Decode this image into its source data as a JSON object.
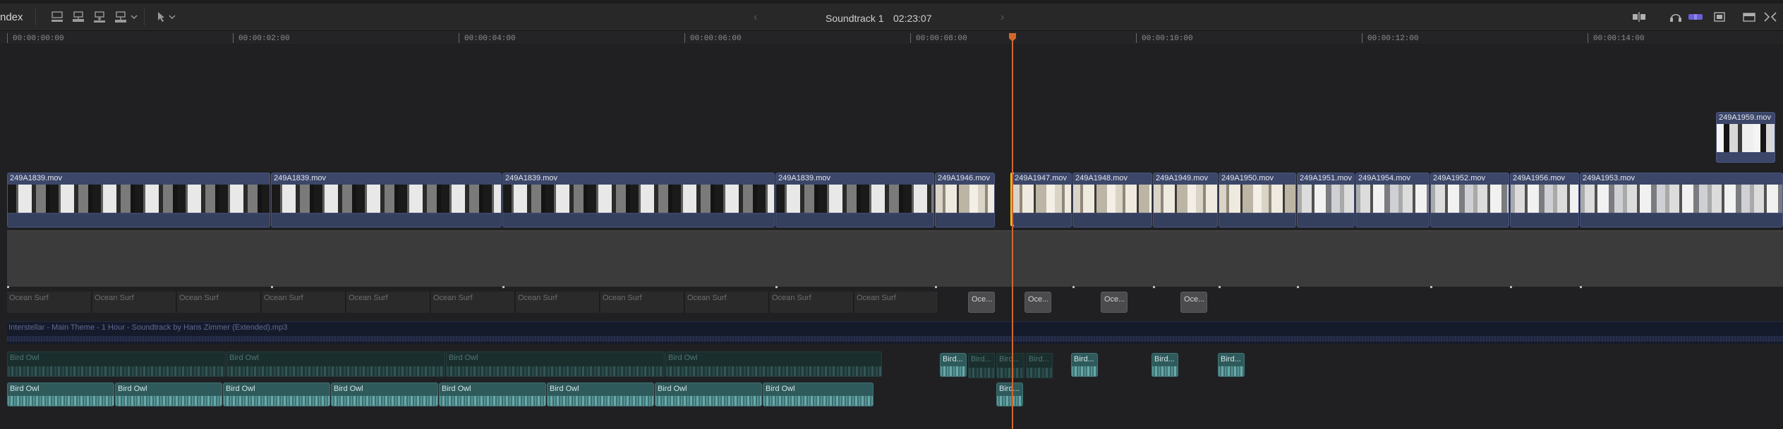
{
  "toolbar": {
    "index_label": "ndex",
    "project_title": "Soundtrack 1",
    "duration": "02:23:07",
    "prev_chevron": "‹",
    "next_chevron": "›"
  },
  "ruler": {
    "labels": [
      "00:00:00:00",
      "00:00:02:00",
      "00:00:04:00",
      "00:00:06:00",
      "00:00:08:00",
      "00:00:10:00",
      "00:00:12:00",
      "00:00:14:00"
    ]
  },
  "timeline": {
    "connected_clip": "249A1959.mov",
    "video_clips": [
      "249A1839.mov",
      "249A1839.mov",
      "249A1839.mov",
      "249A1839.mov",
      "249A1946.mov",
      "249A1947.mov",
      "249A1948.mov",
      "249A1949.mov",
      "249A1950.mov",
      "249A1951.mov",
      "249A1954.mov",
      "249A1952.mov",
      "249A1956.mov",
      "249A1953.mov"
    ],
    "ocean_surf": [
      "Ocean Surf",
      "Ocean Surf",
      "Ocean Surf",
      "Ocean Surf",
      "Ocean Surf",
      "Ocean Surf",
      "Ocean Surf",
      "Ocean Surf",
      "Ocean Surf",
      "Ocean Surf",
      "Ocean Surf"
    ],
    "ocean_short": [
      "Oce...",
      "Oce...",
      "Oce...",
      "Oce..."
    ],
    "music_clip": "Interstellar - Main Theme - 1 Hour - Soundtrack by Hans Zimmer (Extended).mp3",
    "bird_owl_upper": [
      "Bird Owl",
      "Bird Owl",
      "Bird Owl",
      "Bird Owl"
    ],
    "bird_short_upper": [
      "Bird...",
      "Bird...",
      "Bird...",
      "Bird...",
      "Bird...",
      "Bird...",
      "Bird..."
    ],
    "bird_owl_lower": [
      "Bird Owl",
      "Bird Owl",
      "Bird Owl",
      "Bird Owl",
      "Bird Owl",
      "Bird Owl",
      "Bird Owl",
      "Bird Owl"
    ],
    "bird_short_lower": "Bird..."
  },
  "colors": {
    "playhead": "#d2672a",
    "selection": "#f0c419",
    "video_clip": "#3b4668",
    "audio_clip": "#2f5a5c"
  }
}
